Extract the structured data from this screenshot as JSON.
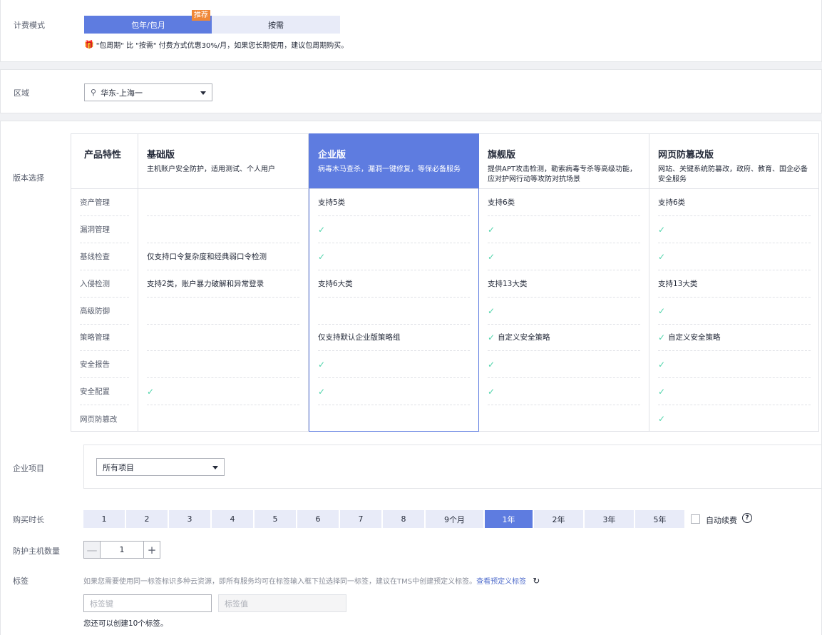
{
  "billing": {
    "label": "计费模式",
    "modes": [
      "包年/包月",
      "按需"
    ],
    "badge": "推荐",
    "tip": "\"包周期\" 比 \"按需\" 付费方式优惠30%/月，如果您长期使用，建议包周期购买。"
  },
  "region": {
    "label": "区域",
    "value": "华东-上海一"
  },
  "edition": {
    "label": "版本选择",
    "feature_header": "产品特性",
    "features": [
      "资产管理",
      "漏洞管理",
      "基线检查",
      "入侵检测",
      "高级防御",
      "策略管理",
      "安全报告",
      "安全配置",
      "网页防篡改"
    ],
    "columns": [
      {
        "title": "基础版",
        "desc": "主机账户安全防护，适用测试、个人用户",
        "cells": [
          "",
          "",
          "仅支持口令复杂度和经典弱口令检测",
          "支持2类，账户暴力破解和异常登录",
          "",
          "",
          "",
          "✓",
          ""
        ]
      },
      {
        "title": "企业版",
        "desc": "病毒木马查杀，漏洞一键修复，等保必备服务",
        "cells": [
          "支持5类",
          "✓",
          "✓",
          "支持6大类",
          "",
          "仅支持默认企业版策略组",
          "✓",
          "✓",
          ""
        ]
      },
      {
        "title": "旗舰版",
        "desc": "提供APT攻击检测，勒索病毒专杀等高级功能，应对护网行动等攻防对抗场景",
        "cells": [
          "支持6类",
          "✓",
          "✓",
          "支持13大类",
          "✓",
          "✓ 自定义安全策略",
          "✓",
          "✓",
          ""
        ]
      },
      {
        "title": "网页防篡改版",
        "desc": "网站、关键系统防篡改，政府、教育、国企必备安全服务",
        "cells": [
          "支持6类",
          "✓",
          "✓",
          "支持13大类",
          "✓",
          "✓ 自定义安全策略",
          "✓",
          "✓",
          "✓"
        ]
      }
    ]
  },
  "project": {
    "label": "企业项目",
    "value": "所有项目"
  },
  "duration": {
    "label": "购买时长",
    "options": [
      "1",
      "2",
      "3",
      "4",
      "5",
      "6",
      "7",
      "8",
      "9个月",
      "1年",
      "2年",
      "3年",
      "5年"
    ],
    "selected": "1年",
    "auto_renew": "自动续费",
    "help": "?"
  },
  "hosts": {
    "label": "防护主机数量",
    "minus": "—",
    "value": "1",
    "plus": "+"
  },
  "tags": {
    "label": "标签",
    "hint": "如果您需要使用同一标签标识多种云资源，即所有服务均可在标签输入框下拉选择同一标签，建议在TMS中创建预定义标签。",
    "link": "查看预定义标签",
    "refresh": "↻",
    "key_placeholder": "标签键",
    "value_placeholder": "标签值",
    "remaining": "您还可以创建10个标签。"
  },
  "colors": {
    "accent": "#5e7ce0",
    "badge": "#f08838",
    "check": "#50d4ab"
  }
}
